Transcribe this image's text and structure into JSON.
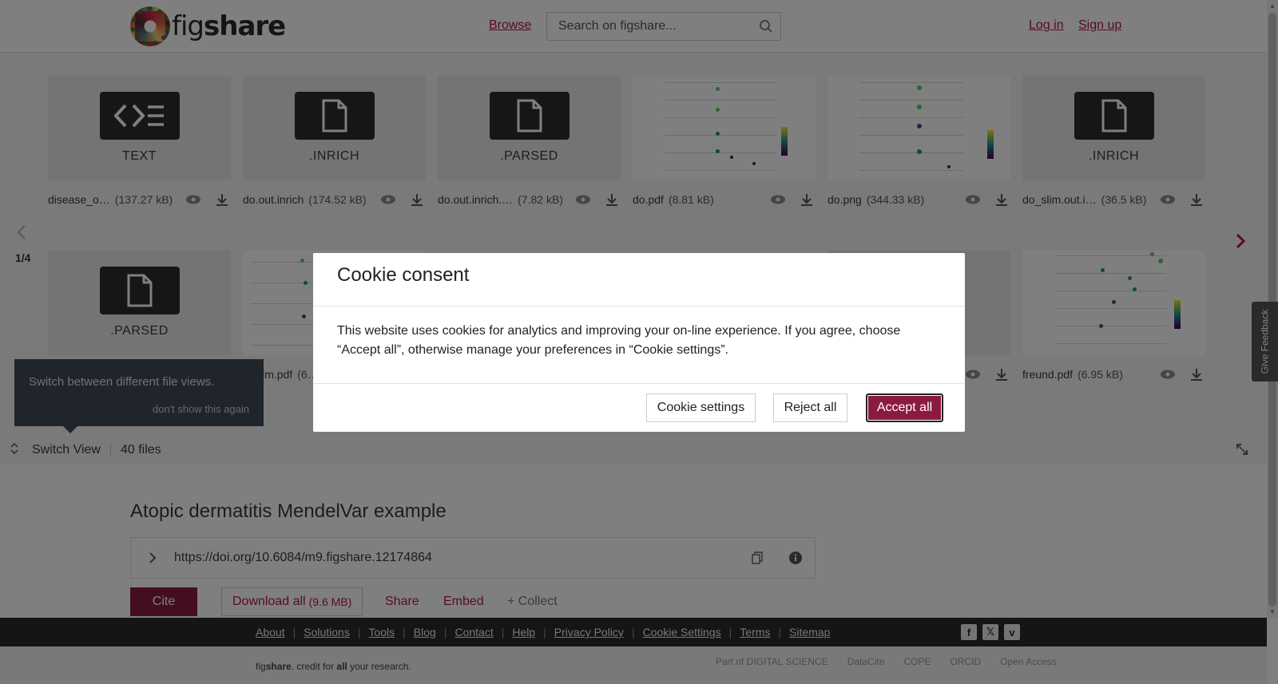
{
  "header": {
    "logo_text_a": "fig",
    "logo_text_b": "share",
    "browse": "Browse",
    "search_placeholder": "Search on figshare...",
    "login": "Log in",
    "signup": "Sign up"
  },
  "viewer": {
    "page_indicator": "1/4",
    "row1": [
      {
        "ext": "TEXT",
        "name": "disease_o…",
        "size": "(137.27 kB)",
        "kind": "code"
      },
      {
        "ext": ".INRICH",
        "name": "do.out.inrich",
        "size": "(174.52 kB)",
        "kind": "file"
      },
      {
        "ext": ".PARSED",
        "name": "do.out.inrich.…",
        "size": "(7.82 kB)",
        "kind": "file"
      },
      {
        "ext": "",
        "name": "do.pdf",
        "size": "(8.81 kB)",
        "kind": "image"
      },
      {
        "ext": "",
        "name": "do.png",
        "size": "(344.33 kB)",
        "kind": "image"
      },
      {
        "ext": ".INRICH",
        "name": "do_slim.out.i…",
        "size": "(36.5 kB)",
        "kind": "file"
      }
    ],
    "row2": [
      {
        "ext": ".PARSED",
        "name": "",
        "size": "",
        "kind": "file"
      },
      {
        "ext": "",
        "name": "…slim.pdf",
        "size": "(6…",
        "kind": "image"
      },
      {
        "ext": "",
        "name": "freund.pdf",
        "size": "(6.95 kB)",
        "kind": "image"
      }
    ],
    "tooltip": {
      "text": "Switch between different file views.",
      "dismiss": "don't show this again"
    },
    "switch_view": "Switch View",
    "file_count": "40 files"
  },
  "item": {
    "title": "Atopic dermatitis MendelVar example",
    "doi": "https://doi.org/10.6084/m9.figshare.12174864",
    "cite": "Cite",
    "download_all": "Download all",
    "download_size": "(9.6 MB)",
    "share": "Share",
    "embed": "Embed",
    "collect": "+ Collect"
  },
  "footer": {
    "links": [
      "About",
      "Solutions",
      "Tools",
      "Blog",
      "Contact",
      "Help",
      "Privacy Policy",
      "Cookie Settings",
      "Terms",
      "Sitemap"
    ],
    "tagline_a": "fig",
    "tagline_b": "share",
    "tagline_c": ". credit for ",
    "tagline_d": "all",
    "tagline_e": " your research.",
    "partners": [
      "Part of DIGITAL SCIENCE",
      "DataCite",
      "COPE",
      "ORCID",
      "Open Access"
    ],
    "social_icons": [
      "facebook-icon",
      "x-icon",
      "vimeo-icon"
    ]
  },
  "feedback": "Give Feedback",
  "cookie_modal": {
    "title": "Cookie consent",
    "body": "This website uses cookies for analytics and improving your on-line experience. If you agree, choose “Accept all”, otherwise manage your preferences in “Cookie settings”.",
    "settings": "Cookie settings",
    "reject": "Reject all",
    "accept": "Accept all"
  },
  "colors": {
    "brand": "#8b1a41",
    "link": "#b21840",
    "footer_bg": "#2a2a2a"
  }
}
